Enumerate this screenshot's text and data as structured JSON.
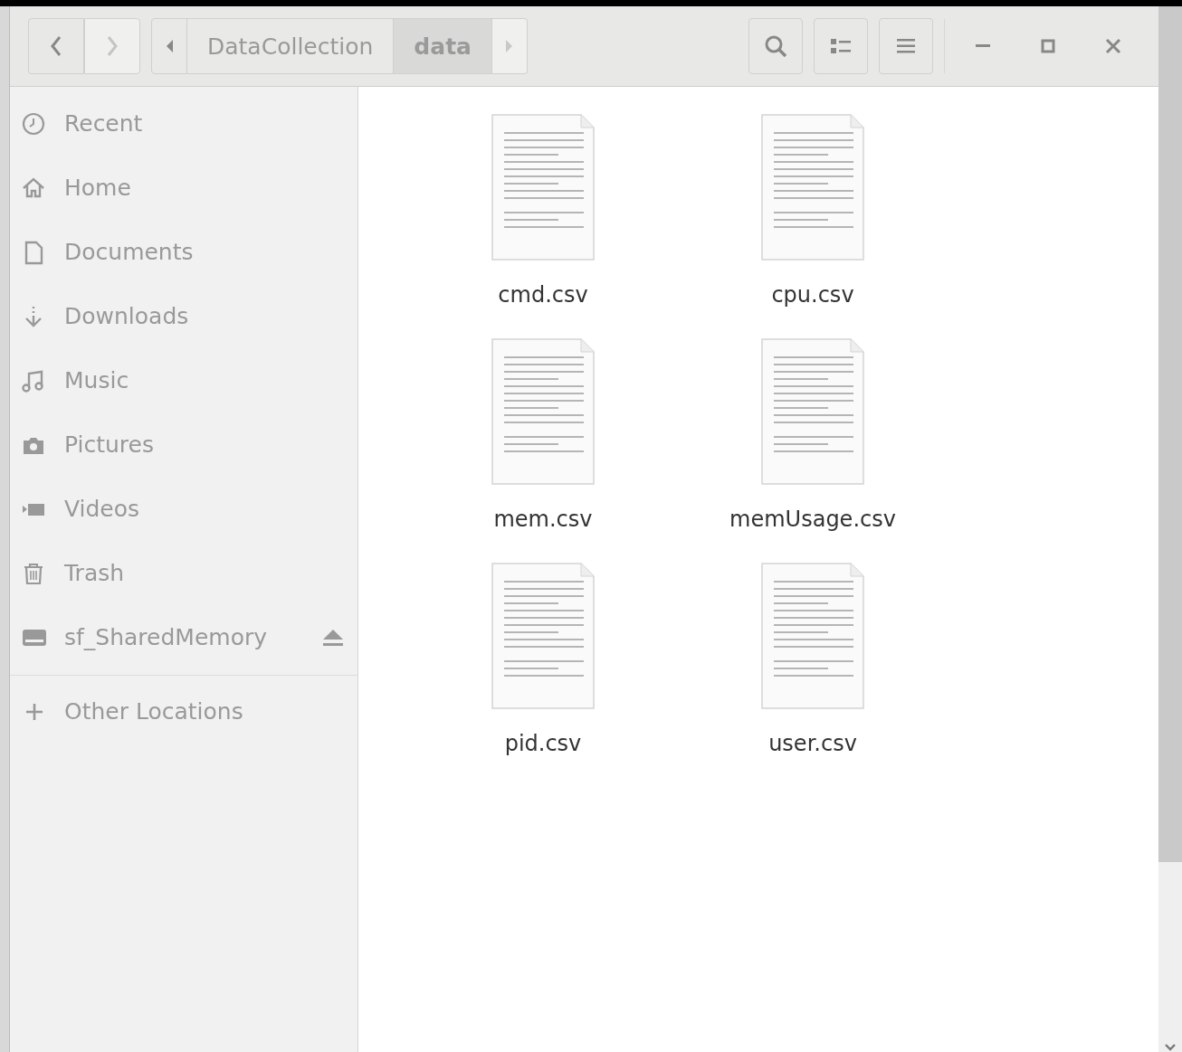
{
  "path_bar": {
    "segments": [
      {
        "label": "DataCollection",
        "selected": false
      },
      {
        "label": "data",
        "selected": true
      }
    ]
  },
  "sidebar": {
    "items": [
      {
        "label": "Recent",
        "ejectable": false
      },
      {
        "label": "Home",
        "ejectable": false
      },
      {
        "label": "Documents",
        "ejectable": false
      },
      {
        "label": "Downloads",
        "ejectable": false
      },
      {
        "label": "Music",
        "ejectable": false
      },
      {
        "label": "Pictures",
        "ejectable": false
      },
      {
        "label": "Videos",
        "ejectable": false
      },
      {
        "label": "Trash",
        "ejectable": false
      },
      {
        "label": "sf_SharedMemory",
        "ejectable": true
      }
    ],
    "other_locations": "Other Locations"
  },
  "files": [
    {
      "name": "cmd.csv"
    },
    {
      "name": "cpu.csv"
    },
    {
      "name": "mem.csv"
    },
    {
      "name": "memUsage.csv"
    },
    {
      "name": "pid.csv"
    },
    {
      "name": "user.csv"
    }
  ]
}
